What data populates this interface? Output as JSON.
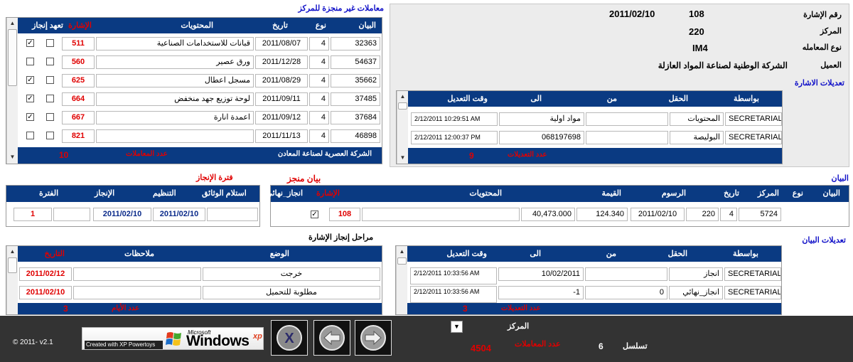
{
  "pending": {
    "title": "معاملات غير منجزة للمركز",
    "headers": {
      "bayan": "البيان",
      "type": "نوع",
      "date": "تاريخ",
      "contents": "المحتويات",
      "ref": "الإشارة",
      "done": "إنجاز",
      "pledge": "تعهد"
    },
    "rows": [
      {
        "bayan": "32363",
        "type": "4",
        "date": "2011/08/07",
        "contents": "قبانات للاستخدامات الصناعية",
        "ref": "511",
        "done": "✓",
        "pledge": ""
      },
      {
        "bayan": "54637",
        "type": "4",
        "date": "2011/12/28",
        "contents": "ورق عصير",
        "ref": "560",
        "done": "",
        "pledge": ""
      },
      {
        "bayan": "35662",
        "type": "4",
        "date": "2011/08/29",
        "contents": "مسجل اعطال",
        "ref": "625",
        "done": "✓",
        "pledge": ""
      },
      {
        "bayan": "37485",
        "type": "4",
        "date": "2011/09/11",
        "contents": "لوحة توزيع جهد منخفض",
        "ref": "664",
        "done": "✓",
        "pledge": ""
      },
      {
        "bayan": "37684",
        "type": "4",
        "date": "2011/09/12",
        "contents": "اعمدة انارة",
        "ref": "667",
        "done": "✓",
        "pledge": ""
      },
      {
        "bayan": "46898",
        "type": "4",
        "date": "2011/11/13",
        "contents": "",
        "ref": "821",
        "done": "",
        "pledge": ""
      }
    ],
    "footer_company": "الشركة العصرية لصناعة المعادن",
    "count_label": "عدد المعاملات",
    "count": "10"
  },
  "info": {
    "ref_label": "رقم الإشارة",
    "ref_value": "108",
    "ref_date": "2011/02/10",
    "center_label": "المركز",
    "center_value": "220",
    "type_label": "نوع المعامله",
    "type_value": "IM4",
    "client_label": "العميل",
    "client_value": "الشركة الوطنية لصناعة المواد العازلة"
  },
  "ref_changes": {
    "title": "تعديلات الاشارة",
    "headers": {
      "by": "بواسطة",
      "field": "الحقل",
      "from": "من",
      "to": "الى",
      "time": "وقت التعديل"
    },
    "rows": [
      {
        "by": "SECRETARIAL",
        "field": "المحتويات",
        "from": "",
        "to": "مواد اولية",
        "time": "2/12/2011 10:29:51 AM"
      },
      {
        "by": "SECRETARIAL",
        "field": "البوليصة",
        "from": "",
        "to": "068197698",
        "time": "2/12/2011 12:00:37 PM"
      }
    ],
    "count_label": "عدد التعديلات",
    "count": "9"
  },
  "completion": {
    "title": "فترة الإنجاز",
    "headers": {
      "period": "الفترة",
      "done": "الإنجاز",
      "org": "التنظيم",
      "docs": "استلام الوثائق"
    },
    "values": {
      "period": "1",
      "done": "2011/02/10",
      "org": "2011/02/10",
      "docs": ""
    }
  },
  "statement": {
    "title": "البيان",
    "done_title": "بيان منجز",
    "headers": {
      "bayan": "البيان",
      "type": "نوع",
      "center": "المركز",
      "date": "تاريخ",
      "fees": "الرسوم",
      "value": "القيمة",
      "contents": "المحتويات",
      "ref": "الإشارة",
      "final": "انجاز_نهائي"
    },
    "values": {
      "bayan": "5724",
      "type": "4",
      "center": "220",
      "date": "2011/02/10",
      "fees": "124.340",
      "value": "40,473.000",
      "contents": "",
      "ref": "108",
      "final": "✓"
    }
  },
  "stages": {
    "title": "مراحل إنجاز الإشارة",
    "headers": {
      "status": "الوضع",
      "notes": "ملاحظات",
      "date": "التاريخ"
    },
    "rows": [
      {
        "status": "خرجت",
        "notes": "",
        "date": "2011/02/12"
      },
      {
        "status": "مطلوبة للتحميل",
        "notes": "",
        "date": "2011/02/10"
      }
    ],
    "count_label": "عدد الأيام",
    "count": "3"
  },
  "stmt_changes": {
    "title": "تعديلات البيان",
    "headers": {
      "by": "بواسطة",
      "field": "الحقل",
      "from": "من",
      "to": "الى",
      "time": "وقت التعديل"
    },
    "rows": [
      {
        "by": "SECRETARIAL",
        "field": "انجاز",
        "from": "",
        "to": "10/02/2011",
        "time": "2/12/2011 10:33:56 AM"
      },
      {
        "by": "SECRETARIAL",
        "field": "انجاز_نهائي",
        "from": "0",
        "to": "-1",
        "time": "2/12/2011 10:33:56 AM"
      }
    ],
    "count_label": "عدد التعديلات",
    "count": "3"
  },
  "bottom": {
    "copyright": "© 2011- v2.1",
    "badge_small": "Created with XP Powertoys",
    "badge_ms": "Microsoft",
    "badge_windows": "Windows",
    "badge_xp": "xp",
    "center_label": "المركز",
    "count_label": "عدد المعاملات",
    "count": "4504",
    "seq_label": "تسلسل",
    "seq": "6"
  },
  "colors": {
    "header": "#0a3a82",
    "accent": "#e00000",
    "bottom_bar": "#333333"
  }
}
